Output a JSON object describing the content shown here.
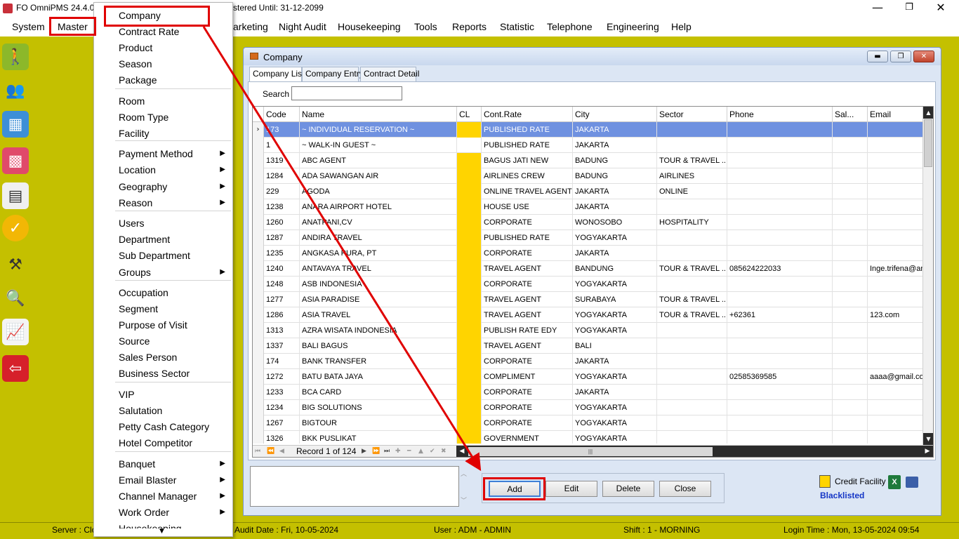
{
  "window": {
    "title": "FO OmniPMS 24.4.0.0",
    "title_tail": "stered Until: 31-12-2099",
    "minimize": "—",
    "maximize": "❐",
    "close": "✕"
  },
  "menubar": {
    "items": [
      "System",
      "Master",
      "arketing",
      "Night Audit",
      "Housekeeping",
      "Tools",
      "Reports",
      "Statistic",
      "Telephone",
      "Engineering",
      "Help"
    ]
  },
  "sidebar": {
    "icons": [
      "walk-icon",
      "guests-icon",
      "floorplan-icon",
      "room-grid-icon",
      "calendar-icon",
      "available-icon",
      "housekeeping-icon",
      "search-chart-icon",
      "statistics-icon",
      "logout-icon"
    ]
  },
  "dropdown": {
    "items": [
      {
        "label": "Company",
        "submenu": false
      },
      {
        "label": "Contract Rate",
        "submenu": false
      },
      {
        "label": "Product",
        "submenu": false
      },
      {
        "label": "Season",
        "submenu": false
      },
      {
        "label": "Package",
        "submenu": false
      },
      {
        "label": "Room",
        "submenu": false
      },
      {
        "label": "Room Type",
        "submenu": false
      },
      {
        "label": "Facility",
        "submenu": false
      },
      {
        "label": "Payment Method",
        "submenu": true
      },
      {
        "label": "Location",
        "submenu": true
      },
      {
        "label": "Geography",
        "submenu": true
      },
      {
        "label": "Reason",
        "submenu": true
      },
      {
        "label": "Users",
        "submenu": false
      },
      {
        "label": "Department",
        "submenu": false
      },
      {
        "label": "Sub Department",
        "submenu": false
      },
      {
        "label": "Groups",
        "submenu": true
      },
      {
        "label": "Occupation",
        "submenu": false
      },
      {
        "label": "Segment",
        "submenu": false
      },
      {
        "label": "Purpose of Visit",
        "submenu": false
      },
      {
        "label": "Source",
        "submenu": false
      },
      {
        "label": "Sales Person",
        "submenu": false
      },
      {
        "label": "Business Sector",
        "submenu": false
      },
      {
        "label": "VIP",
        "submenu": false
      },
      {
        "label": "Salutation",
        "submenu": false
      },
      {
        "label": "Petty Cash Category",
        "submenu": false
      },
      {
        "label": "Hotel Competitor",
        "submenu": false
      },
      {
        "label": "Banquet",
        "submenu": true
      },
      {
        "label": "Email Blaster",
        "submenu": true
      },
      {
        "label": "Channel Manager",
        "submenu": true
      },
      {
        "label": "Work Order",
        "submenu": true
      },
      {
        "label": "Housekeeping",
        "submenu": true
      }
    ],
    "submenu_arrow": "▶",
    "scroll_arrow": "▼"
  },
  "company_window": {
    "title": "Company",
    "tabs": [
      "Company List",
      "Company Entry",
      "Contract Detail"
    ],
    "search_label": "Search",
    "search_value": "",
    "columns": [
      "Code",
      "Name",
      "CL",
      "Cont.Rate",
      "City",
      "Sector",
      "Phone",
      "Sal...",
      "Email"
    ],
    "rows": [
      {
        "code": "173",
        "name": "~ INDIVIDUAL RESERVATION ~",
        "cl": true,
        "rate": "PUBLISHED RATE",
        "city": "JAKARTA",
        "sector": "",
        "phone": "",
        "sal": "",
        "email": "",
        "selected": true
      },
      {
        "code": "1",
        "name": "~ WALK-IN GUEST ~",
        "cl": false,
        "rate": "PUBLISHED RATE",
        "city": "JAKARTA",
        "sector": "",
        "phone": "",
        "sal": "",
        "email": ""
      },
      {
        "code": "1319",
        "name": "ABC AGENT",
        "cl": true,
        "rate": "BAGUS JATI NEW",
        "city": "BADUNG",
        "sector": "TOUR & TRAVEL ...",
        "phone": "",
        "sal": "",
        "email": ""
      },
      {
        "code": "1284",
        "name": "ADA SAWANGAN AIR",
        "cl": true,
        "rate": "AIRLINES CREW",
        "city": "BADUNG",
        "sector": "AIRLINES",
        "phone": "",
        "sal": "",
        "email": ""
      },
      {
        "code": "229",
        "name": "AGODA",
        "cl": true,
        "rate": "ONLINE TRAVEL AGENT",
        "city": "JAKARTA",
        "sector": "ONLINE",
        "phone": "",
        "sal": "",
        "email": ""
      },
      {
        "code": "1238",
        "name": "ANARA AIRPORT HOTEL",
        "cl": true,
        "rate": "HOUSE USE",
        "city": "JAKARTA",
        "sector": "",
        "phone": "",
        "sal": "",
        "email": ""
      },
      {
        "code": "1260",
        "name": "ANATPANI,CV",
        "cl": true,
        "rate": "CORPORATE",
        "city": "WONOSOBO",
        "sector": "HOSPITALITY",
        "phone": "",
        "sal": "",
        "email": ""
      },
      {
        "code": "1287",
        "name": "ANDIRA TRAVEL",
        "cl": true,
        "rate": "PUBLISHED RATE",
        "city": "YOGYAKARTA",
        "sector": "",
        "phone": "",
        "sal": "",
        "email": ""
      },
      {
        "code": "1235",
        "name": "ANGKASA PURA, PT",
        "cl": true,
        "rate": "CORPORATE",
        "city": "JAKARTA",
        "sector": "",
        "phone": "",
        "sal": "",
        "email": ""
      },
      {
        "code": "1240",
        "name": "ANTAVAYA TRAVEL",
        "cl": true,
        "rate": "TRAVEL AGENT",
        "city": "BANDUNG",
        "sector": "TOUR & TRAVEL ...",
        "phone": "085624222033",
        "sal": "",
        "email": "Inge.trifena@an"
      },
      {
        "code": "1248",
        "name": "ASB INDONESIA",
        "cl": true,
        "rate": "CORPORATE",
        "city": "YOGYAKARTA",
        "sector": "",
        "phone": "",
        "sal": "",
        "email": ""
      },
      {
        "code": "1277",
        "name": "ASIA PARADISE",
        "cl": true,
        "rate": "TRAVEL AGENT",
        "city": "SURABAYA",
        "sector": "TOUR & TRAVEL ...",
        "phone": "",
        "sal": "",
        "email": ""
      },
      {
        "code": "1286",
        "name": "ASIA TRAVEL",
        "cl": true,
        "rate": "TRAVEL AGENT",
        "city": "YOGYAKARTA",
        "sector": "TOUR & TRAVEL ...",
        "phone": "+62361",
        "sal": "",
        "email": "123.com"
      },
      {
        "code": "1313",
        "name": "AZRA WISATA INDONESIA",
        "cl": true,
        "rate": "PUBLISH RATE EDY",
        "city": "YOGYAKARTA",
        "sector": "",
        "phone": "",
        "sal": "",
        "email": ""
      },
      {
        "code": "1337",
        "name": "BALI BAGUS",
        "cl": true,
        "rate": "TRAVEL AGENT",
        "city": "BALI",
        "sector": "",
        "phone": "",
        "sal": "",
        "email": ""
      },
      {
        "code": "174",
        "name": "BANK TRANSFER",
        "cl": true,
        "rate": "CORPORATE",
        "city": "JAKARTA",
        "sector": "",
        "phone": "",
        "sal": "",
        "email": ""
      },
      {
        "code": "1272",
        "name": "BATU BATA JAYA",
        "cl": true,
        "rate": "COMPLIMENT",
        "city": "YOGYAKARTA",
        "sector": "",
        "phone": "02585369585",
        "sal": "",
        "email": "aaaa@gmail.com"
      },
      {
        "code": "1233",
        "name": "BCA CARD",
        "cl": true,
        "rate": "CORPORATE",
        "city": "JAKARTA",
        "sector": "",
        "phone": "",
        "sal": "",
        "email": ""
      },
      {
        "code": "1234",
        "name": "BIG SOLUTIONS",
        "cl": true,
        "rate": "CORPORATE",
        "city": "YOGYAKARTA",
        "sector": "",
        "phone": "",
        "sal": "",
        "email": ""
      },
      {
        "code": "1267",
        "name": "BIGTOUR",
        "cl": true,
        "rate": "CORPORATE",
        "city": "YOGYAKARTA",
        "sector": "",
        "phone": "",
        "sal": "",
        "email": ""
      },
      {
        "code": "1326",
        "name": "BKK PUSLIKAT",
        "cl": true,
        "rate": "GOVERNMENT",
        "city": "YOGYAKARTA",
        "sector": "",
        "phone": "",
        "sal": "",
        "email": ""
      }
    ],
    "record_label": "Record 1 of 124",
    "buttons": {
      "add": "Add",
      "edit": "Edit",
      "delete": "Delete",
      "close": "Close"
    },
    "legend_credit": "Credit Facility",
    "legend_blacklisted": "Blacklisted",
    "excel_label": "X"
  },
  "statusbar": {
    "server": "Server : Clo",
    "audit_date": "Audit Date : Fri, 10-05-2024",
    "user": "User : ADM - ADMIN",
    "shift": "Shift : 1 - MORNING",
    "login_time": "Login Time : Mon, 13-05-2024 09:54"
  },
  "colors": {
    "background": "#c4c000",
    "selected_row": "#6f91e0",
    "credit_facility": "#ffd400",
    "blacklisted": "#1536c6",
    "annotation": "#e00000"
  }
}
